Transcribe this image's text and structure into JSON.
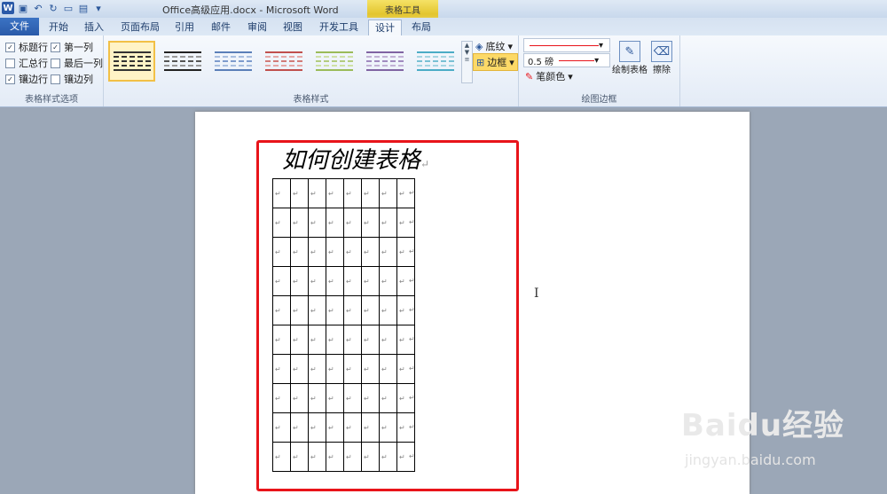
{
  "window": {
    "title": "Office高级应用.docx - Microsoft Word",
    "context_label": "表格工具"
  },
  "tabs": [
    "文件",
    "开始",
    "插入",
    "页面布局",
    "引用",
    "邮件",
    "审阅",
    "视图",
    "开发工具",
    "设计",
    "布局"
  ],
  "ribbon": {
    "style_options": {
      "label": "表格样式选项",
      "items": [
        {
          "label": "标题行",
          "checked": true
        },
        {
          "label": "第一列",
          "checked": true
        },
        {
          "label": "汇总行",
          "checked": false
        },
        {
          "label": "最后一列",
          "checked": false
        },
        {
          "label": "镶边行",
          "checked": true
        },
        {
          "label": "镶边列",
          "checked": false
        }
      ]
    },
    "table_styles": {
      "label": "表格样式",
      "shading_label": "底纹",
      "borders_label": "边框"
    },
    "draw_borders": {
      "label": "绘图边框",
      "weight_value": "0.5 磅",
      "pen_color_label": "笔颜色",
      "draw_table_label": "绘制表格",
      "erase_label": "擦除"
    }
  },
  "colors": {
    "accent": "#2b579a",
    "highlight_box": "#e8141a",
    "context_tab": "#e3c52e"
  },
  "document": {
    "heading": "如何创建表格",
    "return_mark": "↵",
    "table": {
      "rows": 10,
      "cols": 8
    }
  },
  "watermark": {
    "brand": "Baidu经验",
    "url": "jingyan.baidu.com"
  }
}
